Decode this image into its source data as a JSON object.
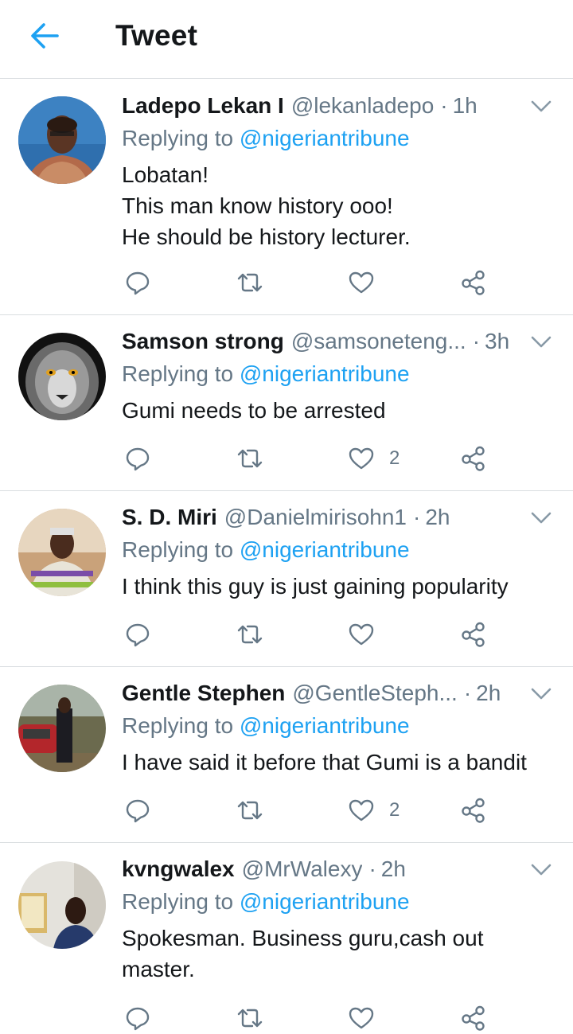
{
  "header": {
    "back_icon": "arrow-left-icon",
    "title": "Tweet",
    "accent_color": "#1da1f2"
  },
  "tweets": [
    {
      "name": "Ladepo Lekan I",
      "handle": "@lekanladepo",
      "separator": "·",
      "time": "1h",
      "replying_prefix": "Replying to",
      "replying_to": "@nigeriantribune",
      "text": "Lobatan!\nThis man know history ooo!\nHe should be history lecturer.",
      "reply_count": "",
      "retweet_count": "",
      "like_count": ""
    },
    {
      "name": "Samson strong",
      "handle": "@samsoneteng...",
      "separator": "·",
      "time": "3h",
      "replying_prefix": "Replying to",
      "replying_to": "@nigeriantribune",
      "text": "Gumi needs to be arrested",
      "reply_count": "",
      "retweet_count": "",
      "like_count": "2"
    },
    {
      "name": "S. D. Miri",
      "handle": "@Danielmirisohn1",
      "separator": "·",
      "time": "2h",
      "replying_prefix": "Replying to",
      "replying_to": "@nigeriantribune",
      "text": "I think this guy is just gaining popularity",
      "reply_count": "",
      "retweet_count": "",
      "like_count": ""
    },
    {
      "name": "Gentle Stephen",
      "handle": "@GentleSteph...",
      "separator": "·",
      "time": "2h",
      "replying_prefix": "Replying to",
      "replying_to": "@nigeriantribune",
      "text": "I have said it before that Gumi is a bandit",
      "reply_count": "",
      "retweet_count": "",
      "like_count": "2"
    },
    {
      "name": "kvngwalex",
      "handle": "@MrWalexy",
      "separator": "·",
      "time": "2h",
      "replying_prefix": "Replying to",
      "replying_to": "@nigeriantribune",
      "text": "Spokesman. Business guru,cash out master.",
      "reply_count": "",
      "retweet_count": "",
      "like_count": ""
    }
  ],
  "icons": {
    "reply": "reply-icon",
    "retweet": "retweet-icon",
    "like": "heart-icon",
    "share": "share-icon",
    "more": "chevron-down-icon"
  },
  "colors": {
    "primary_text": "#14171a",
    "secondary_text": "#657786",
    "link": "#1da1f2",
    "divider": "#d9dde0"
  }
}
